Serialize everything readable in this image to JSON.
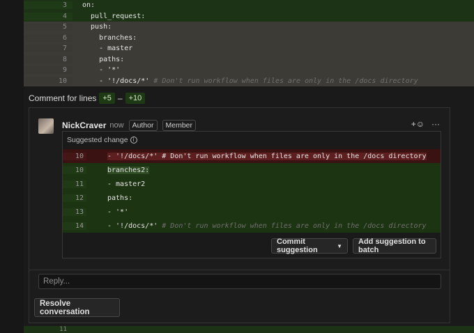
{
  "top_diff": [
    {
      "line": "3",
      "code": "on:",
      "style": "green"
    },
    {
      "line": "4",
      "code": "  pull_request:",
      "style": "green"
    },
    {
      "line": "5",
      "code": "  push:",
      "style": "gray"
    },
    {
      "line": "6",
      "code": "    branches:",
      "style": "gray"
    },
    {
      "line": "7",
      "code": "    - master",
      "style": "gray"
    },
    {
      "line": "8",
      "code": "    paths:",
      "style": "gray"
    },
    {
      "line": "9",
      "code": "    - '*'",
      "style": "gray"
    },
    {
      "line": "10",
      "code": "    - '!/docs/*'",
      "comment": " # Don't run workflow when files are only in the /docs directory",
      "style": "gray"
    }
  ],
  "comment_for": {
    "label": "Comment for lines",
    "from": "+5",
    "dash": "–",
    "to": "+10"
  },
  "comment": {
    "author": "NickCraver",
    "time": "now",
    "badges": [
      "Author",
      "Member"
    ],
    "react_icon": "+☺",
    "more_icon": "···"
  },
  "suggestion": {
    "title": "Suggested change",
    "info_icon": "i",
    "rows": [
      {
        "line": "10",
        "kind": "del",
        "code": "- '!/docs/*' # Don't run workflow when files are only in the /docs directory"
      },
      {
        "line": "10",
        "kind": "add",
        "code": "branches2:"
      },
      {
        "line": "11",
        "kind": "add",
        "code": "- master2"
      },
      {
        "line": "12",
        "kind": "add",
        "code": "paths:"
      },
      {
        "line": "13",
        "kind": "add",
        "code": "- '*'"
      },
      {
        "line": "14",
        "kind": "add",
        "code": "- '!/docs/*'",
        "comment": " # Don't run workflow when files are only in the /docs directory"
      }
    ],
    "commit_button": "Commit suggestion",
    "batch_button": "Add suggestion to batch"
  },
  "reply_placeholder": "Reply...",
  "resolve_button": "Resolve conversation",
  "bottom_line": "11"
}
